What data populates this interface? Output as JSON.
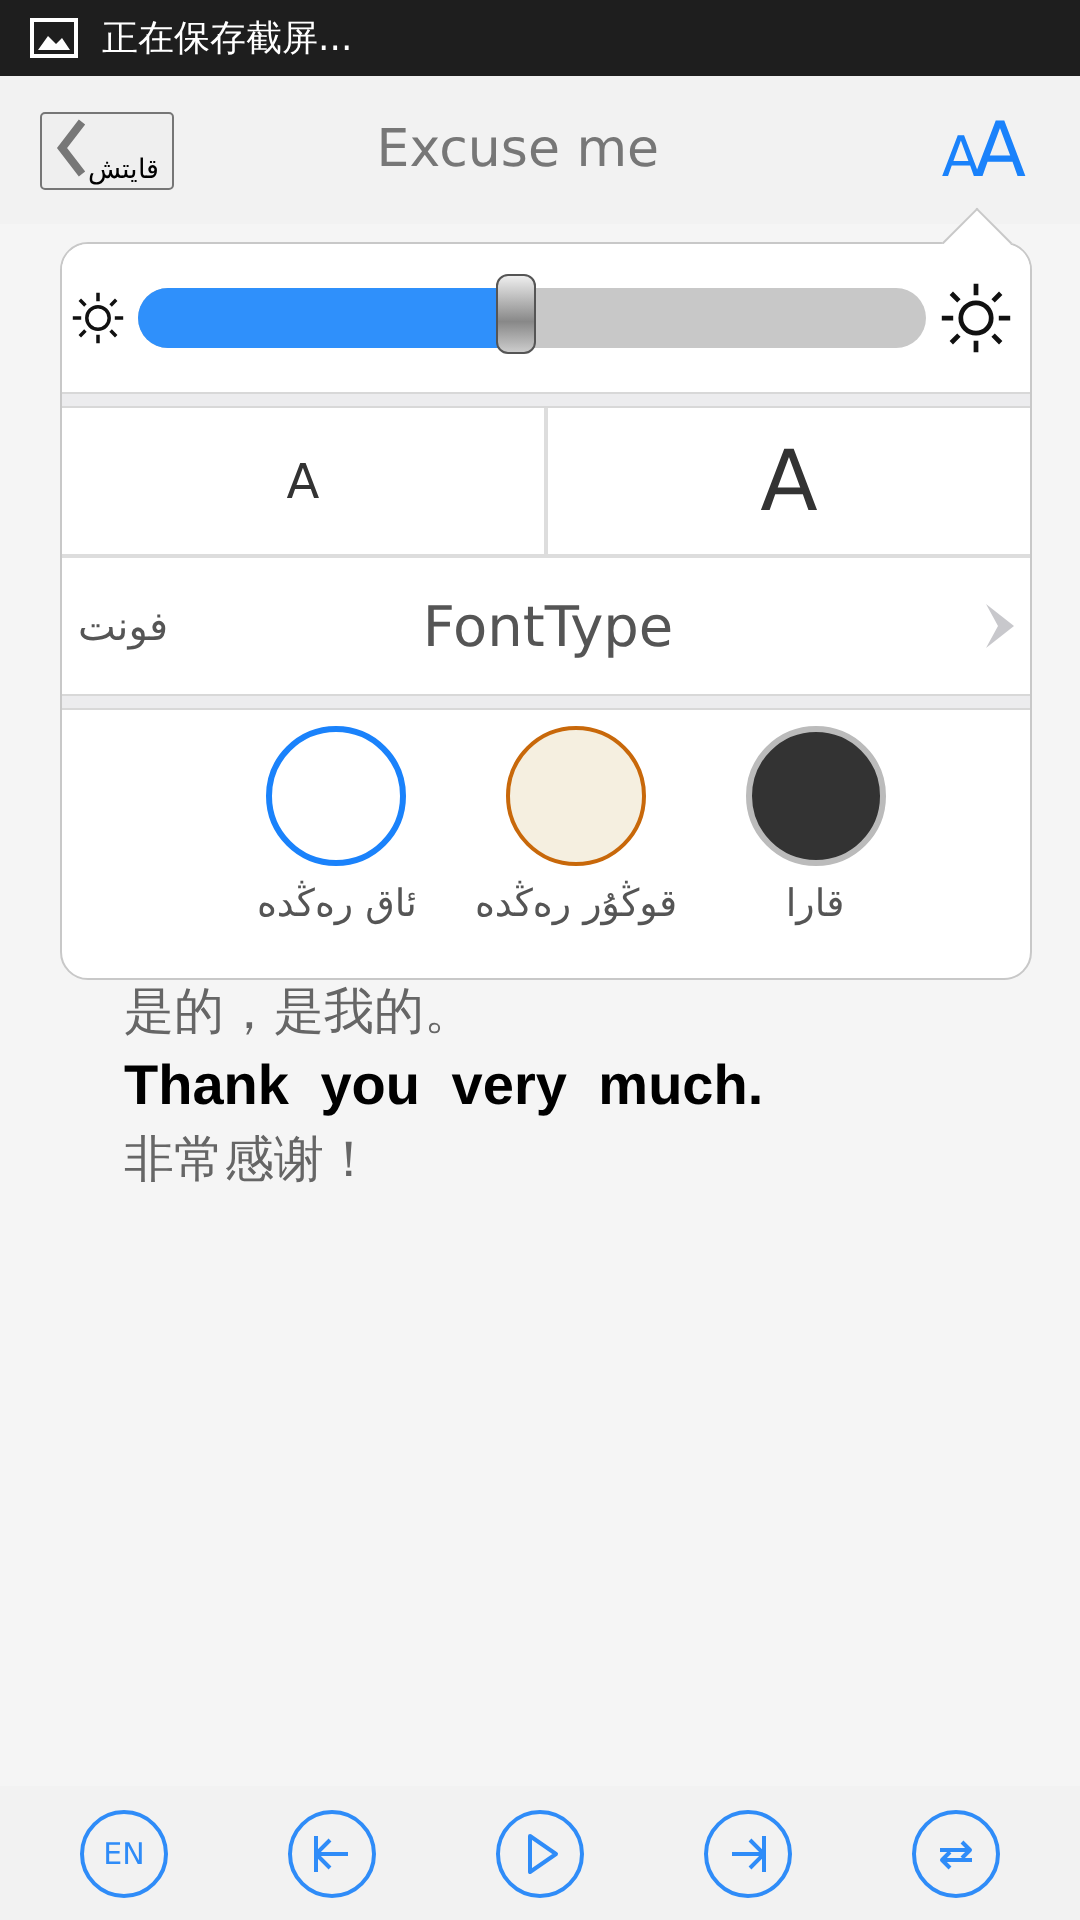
{
  "status_bar": {
    "notification": "正在保存截屏..."
  },
  "nav_bar": {
    "back_label": "قايتش",
    "title": "Excuse me",
    "font_button": "AA"
  },
  "settings_popup": {
    "brightness": {
      "level": 0.48
    },
    "font_sizes": [
      {
        "label": "A",
        "kind": "large"
      },
      {
        "label": "A",
        "kind": "small"
      }
    ],
    "font_type": {
      "label": "فونت",
      "value": "FontType"
    },
    "themes": [
      {
        "label": "قارا",
        "color": "#333333",
        "selected": false
      },
      {
        "label": "قوڭۇر رەڭدە",
        "color": "#f5efe0",
        "selected": false
      },
      {
        "label": "ئاق رەڭدە",
        "color": "#ffffff",
        "selected": true
      }
    ]
  },
  "content": [
    {
      "text": "是的，是我的。",
      "kind": "translation"
    },
    {
      "text": "Thank you very much.",
      "kind": "phrase"
    },
    {
      "text": "非常感谢！",
      "kind": "translation"
    }
  ],
  "toolbar": [
    {
      "kind": "language",
      "label": "EN"
    },
    {
      "kind": "previous"
    },
    {
      "kind": "play"
    },
    {
      "kind": "next"
    },
    {
      "kind": "repeat"
    }
  ]
}
